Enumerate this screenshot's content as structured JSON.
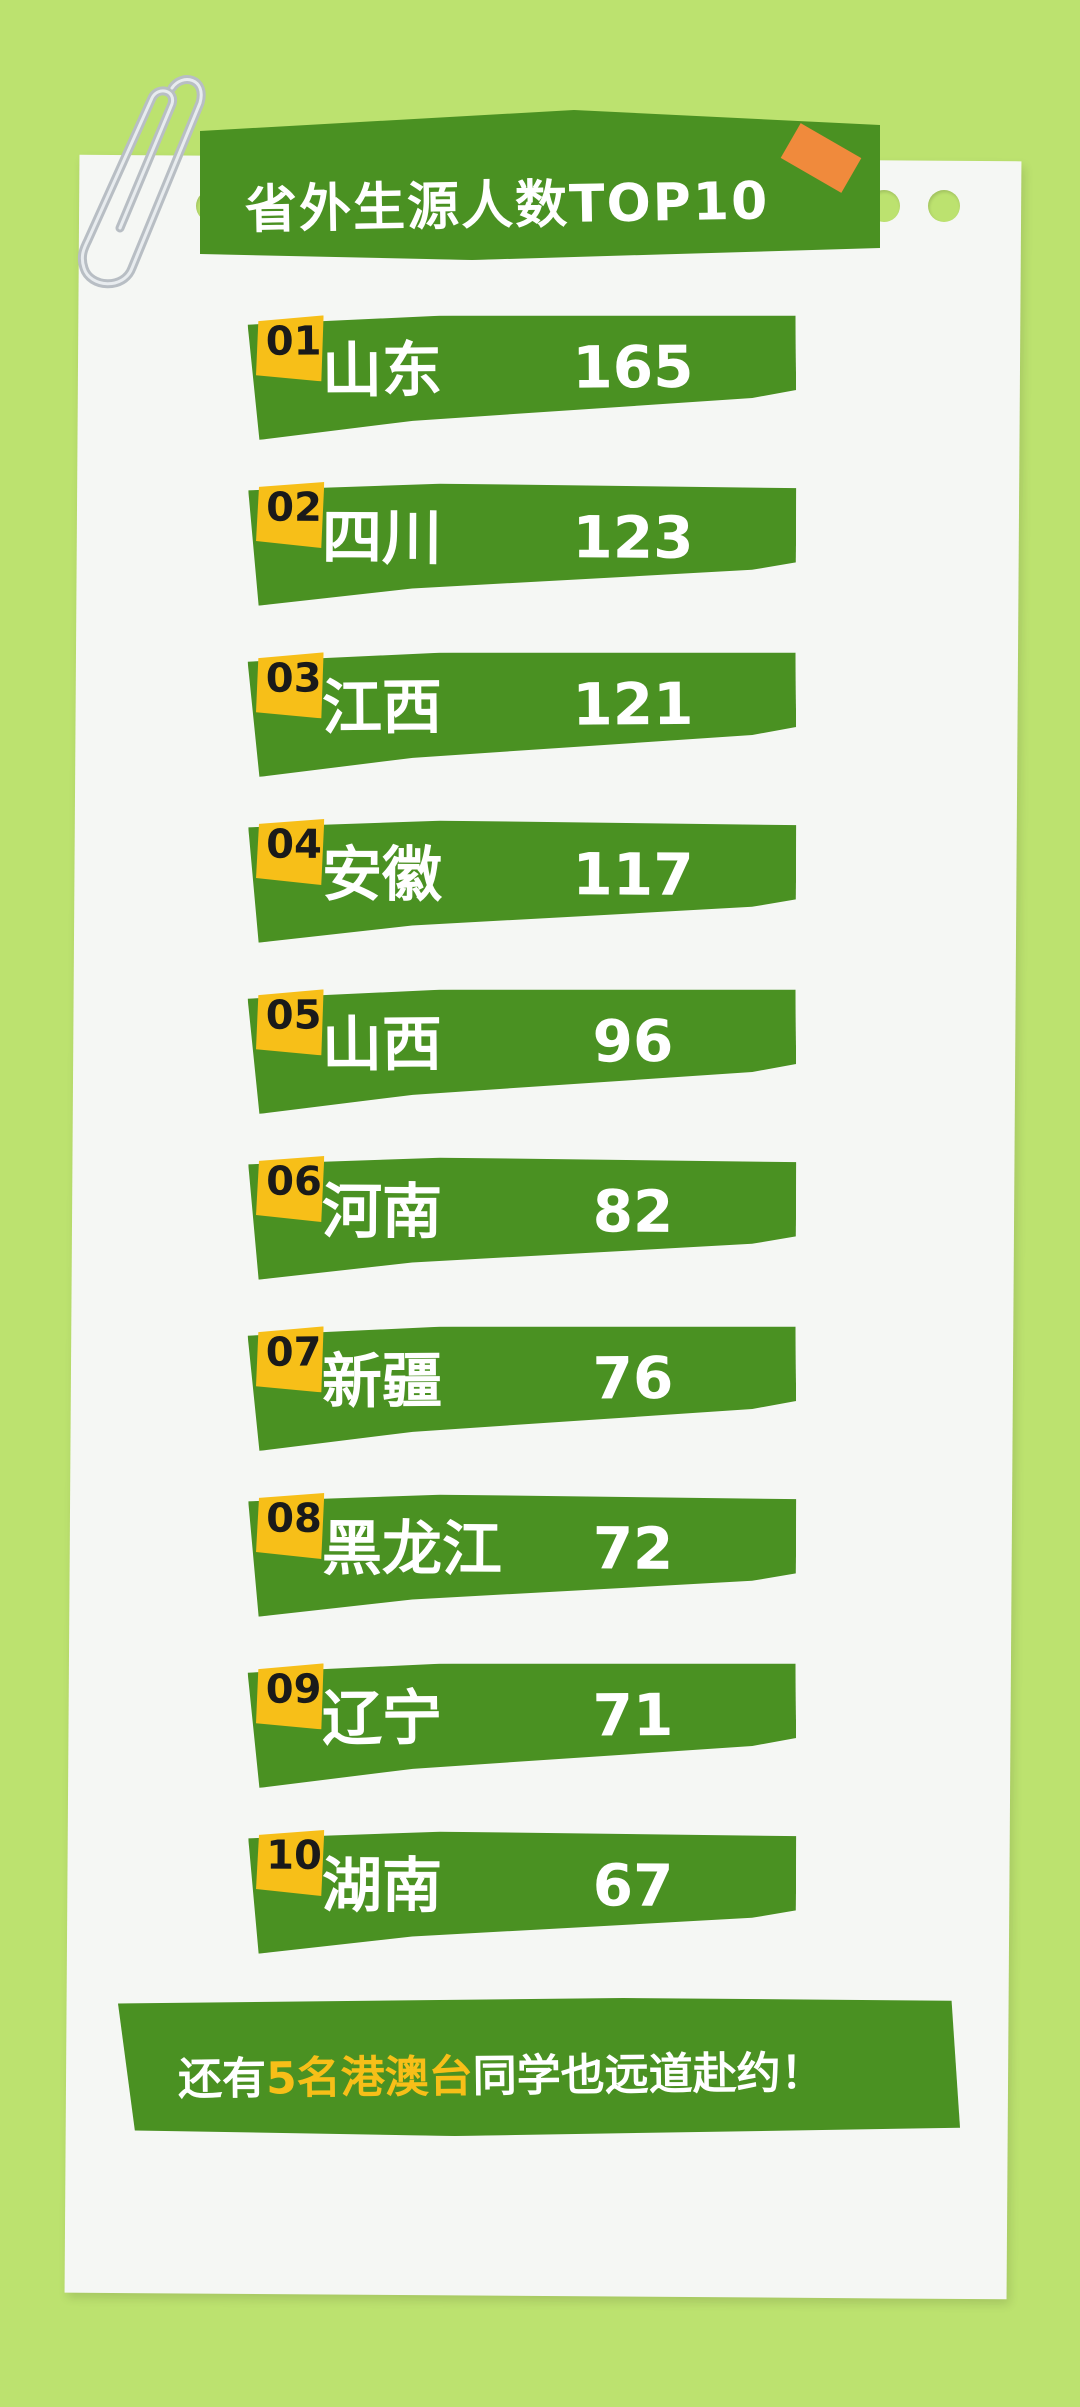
{
  "title": "省外生源人数TOP10",
  "rows": [
    {
      "rank": "01",
      "name": "山东",
      "value": "165"
    },
    {
      "rank": "02",
      "name": "四川",
      "value": "123"
    },
    {
      "rank": "03",
      "name": "江西",
      "value": "121"
    },
    {
      "rank": "04",
      "name": "安徽",
      "value": "117"
    },
    {
      "rank": "05",
      "name": "山西",
      "value": "96"
    },
    {
      "rank": "06",
      "name": "河南",
      "value": "82"
    },
    {
      "rank": "07",
      "name": "新疆",
      "value": "76"
    },
    {
      "rank": "08",
      "name": "黑龙江",
      "value": "72"
    },
    {
      "rank": "09",
      "name": "辽宁",
      "value": "71"
    },
    {
      "rank": "10",
      "name": "湖南",
      "value": "67"
    }
  ],
  "footer": {
    "prefix": "还有",
    "highlight": "5名港澳台",
    "suffix": "同学也远道赴约！"
  },
  "colors": {
    "background": "#bce26f",
    "paper": "#f5f7f4",
    "banner_green": "#4a9122",
    "badge_yellow": "#f7bf18",
    "tape_orange": "#f08a3c"
  },
  "icons": [
    "paperclip-icon"
  ]
}
